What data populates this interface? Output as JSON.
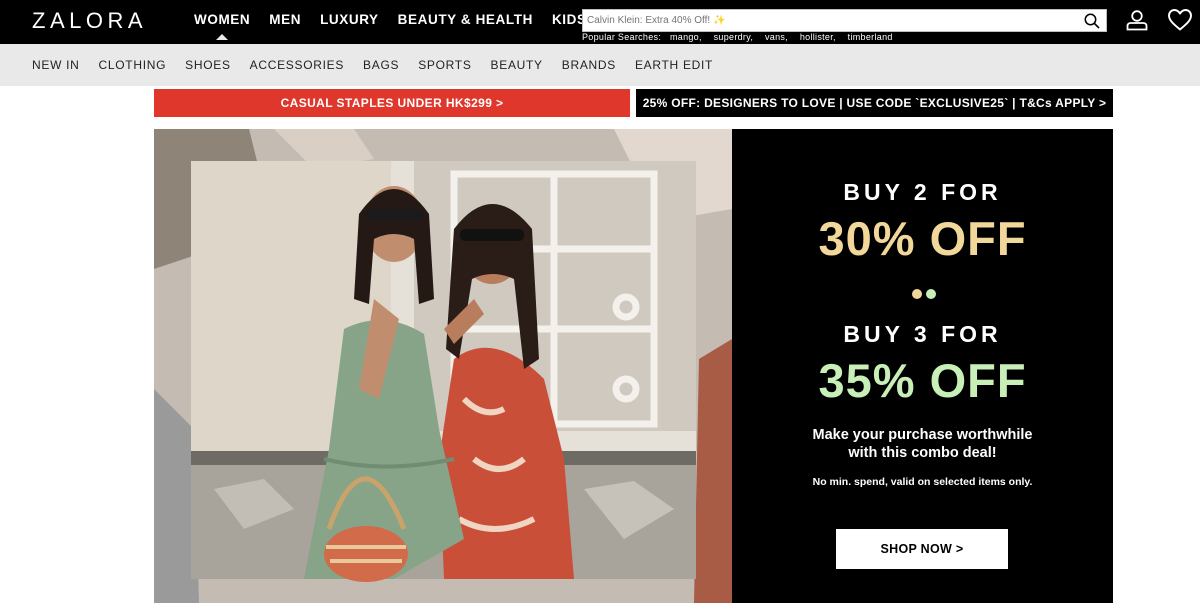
{
  "header": {
    "logo": "ZALORA",
    "nav": [
      "WOMEN",
      "MEN",
      "LUXURY",
      "BEAUTY & HEALTH",
      "KIDS"
    ],
    "active_nav": "WOMEN",
    "search": {
      "placeholder": "Calvin Klein: Extra 40% Off! ✨",
      "popular_label": "Popular Searches:",
      "popular": [
        "mango,",
        "superdry,",
        "vans,",
        "hollister,",
        "timberland"
      ]
    },
    "icons": [
      "search-icon",
      "user-icon",
      "heart-icon"
    ]
  },
  "categories": [
    "NEW IN",
    "CLOTHING",
    "SHOES",
    "ACCESSORIES",
    "BAGS",
    "SPORTS",
    "BEAUTY",
    "BRANDS",
    "EARTH EDIT"
  ],
  "promos": {
    "left": "CASUAL STAPLES UNDER HK$299 >",
    "right": "25% OFF: DESIGNERS TO LOVE | USE CODE `EXCLUSIVE25` | T&Cs APPLY >"
  },
  "hero": {
    "buy1": "BUY 2 FOR",
    "off1": "30% OFF",
    "buy2": "BUY 3 FOR",
    "off2": "35% OFF",
    "desc_line1": "Make your purchase worthwhile",
    "desc_line2": "with this combo deal!",
    "fine_print": "No min. spend, valid on selected items only.",
    "cta": "SHOP NOW >",
    "colors": {
      "gold": "#f2d79a",
      "mint": "#c8efb7",
      "promo_red": "#e0372c"
    }
  }
}
